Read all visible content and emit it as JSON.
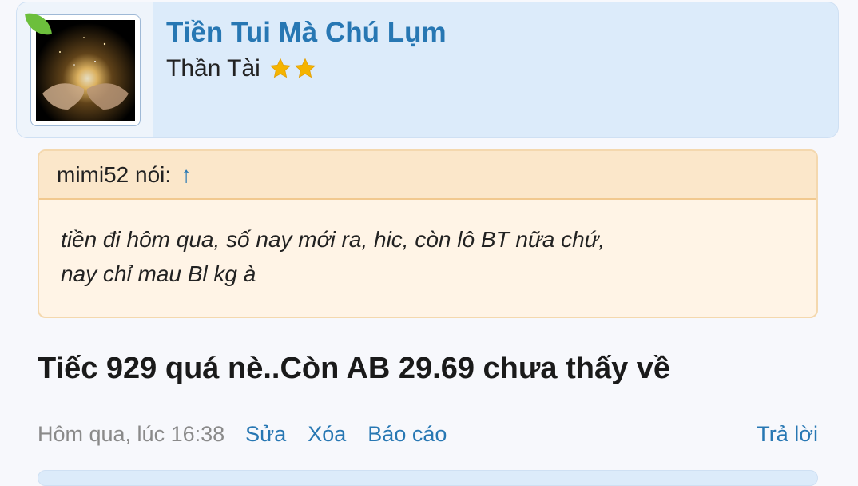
{
  "user": {
    "name": "Tiền Tui Mà Chú Lụm",
    "title": "Thần Tài",
    "star_count": 2,
    "star_color": "#f5b400",
    "avatar_icon": "glowing-hands-image"
  },
  "quote": {
    "author_line": "mimi52 nói:",
    "jump_icon": "↑",
    "lines": [
      "tiền đi hôm qua, số nay mới ra, hic, còn lô BT nữa chứ,",
      "nay chỉ mau Bl kg à"
    ]
  },
  "post": {
    "text": "Tiếc 929 quá nè..Còn AB 29.69 chưa thấy về"
  },
  "meta": {
    "timestamp": "Hôm qua, lúc 16:38",
    "edit_label": "Sửa",
    "delete_label": "Xóa",
    "report_label": "Báo cáo",
    "reply_label": "Trả lời"
  },
  "colors": {
    "link": "#2777b3",
    "user_card_bg": "#dcebfa",
    "quote_bg": "#fff4e6",
    "quote_header_bg": "#fbe7ca"
  }
}
